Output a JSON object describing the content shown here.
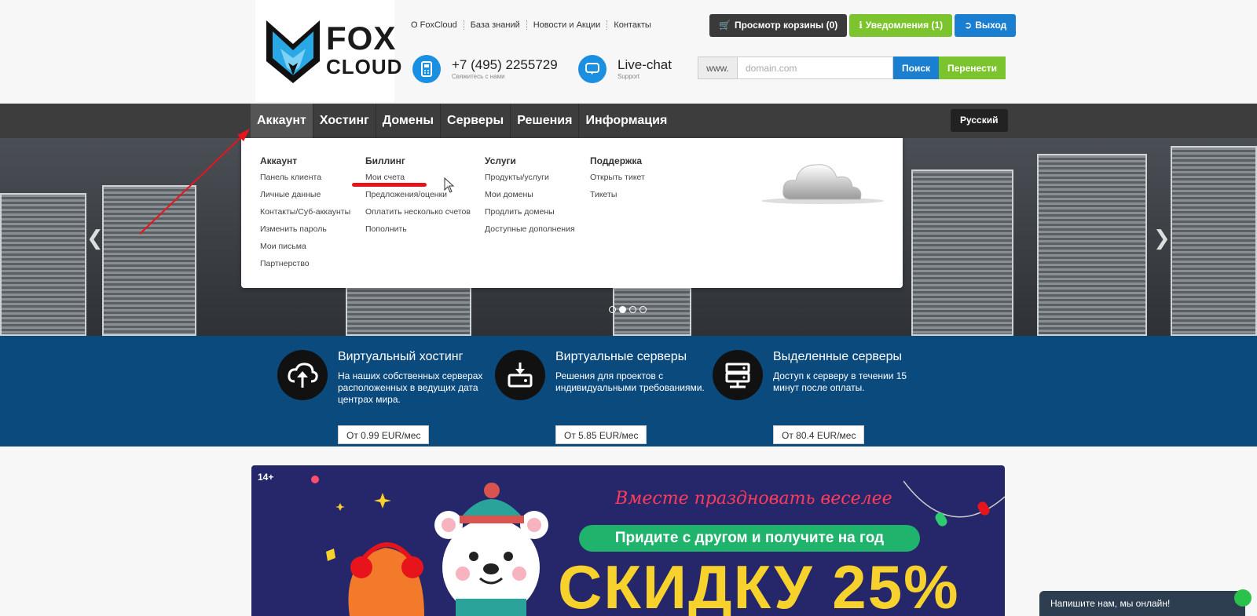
{
  "logo": {
    "line1": "FOX",
    "line2": "CLOUD"
  },
  "top_links": [
    "О FoxCloud",
    "База знаний",
    "Новости и Акции",
    "Контакты"
  ],
  "phone": {
    "number": "+7 (495) 2255729",
    "caption": "Свяжитесь с нами"
  },
  "livechat": {
    "title": "Live-chat",
    "caption": "Support"
  },
  "buttons": {
    "cart": "Просмотр корзины (0)",
    "notifications": "Уведомления (1)",
    "logout": "Выход"
  },
  "search": {
    "prefix": "www.",
    "placeholder": "domain.com",
    "search_label": "Поиск",
    "transfer_label": "Перенести"
  },
  "nav": [
    "Аккаунт",
    "Хостинг",
    "Домены",
    "Серверы",
    "Решения",
    "Информация"
  ],
  "language": "Русский",
  "mega_menu": {
    "account": {
      "title": "Аккаунт",
      "items": [
        "Панель клиента",
        "Личные данные",
        "Контакты/Суб-аккаунты",
        "Изменить пароль",
        "Мои письма",
        "Партнерство"
      ]
    },
    "billing": {
      "title": "Биллинг",
      "items": [
        "Мои счета",
        "Предложения/оценки",
        "Оплатить несколько счетов",
        "Пополнить"
      ]
    },
    "services": {
      "title": "Услуги",
      "items": [
        "Продукты/услуги",
        "Мои домены",
        "Продлить домены",
        "Доступные дополнения"
      ]
    },
    "support": {
      "title": "Поддержка",
      "items": [
        "Открыть тикет",
        "Тикеты"
      ]
    }
  },
  "features": [
    {
      "title": "Виртуальный хостинг",
      "desc": "На наших собственных серверах расположенных в ведущих дата центрах мира.",
      "price": "От 0.99 EUR/мес"
    },
    {
      "title": "Виртуальные серверы",
      "desc": "Решения для проектов с индивидуальными требованиями.",
      "price": "От 5.85 EUR/мес"
    },
    {
      "title": "Выделенные серверы",
      "desc": "Доступ к серверу в течении 15 минут после оплаты.",
      "price": "От 80.4 EUR/мес"
    }
  ],
  "promo": {
    "age": "14+",
    "subtitle": "Вместе праздновать веселее",
    "pill": "Придите с другом и получите на год",
    "big": "СКИДКУ 25%"
  },
  "chat_widget": "Напишите нам, мы онлайн!",
  "colors": {
    "accent_blue": "#1b7fd1",
    "accent_green": "#7cc42d",
    "band": "#0b4a7d",
    "annotation_red": "#e8141b"
  }
}
